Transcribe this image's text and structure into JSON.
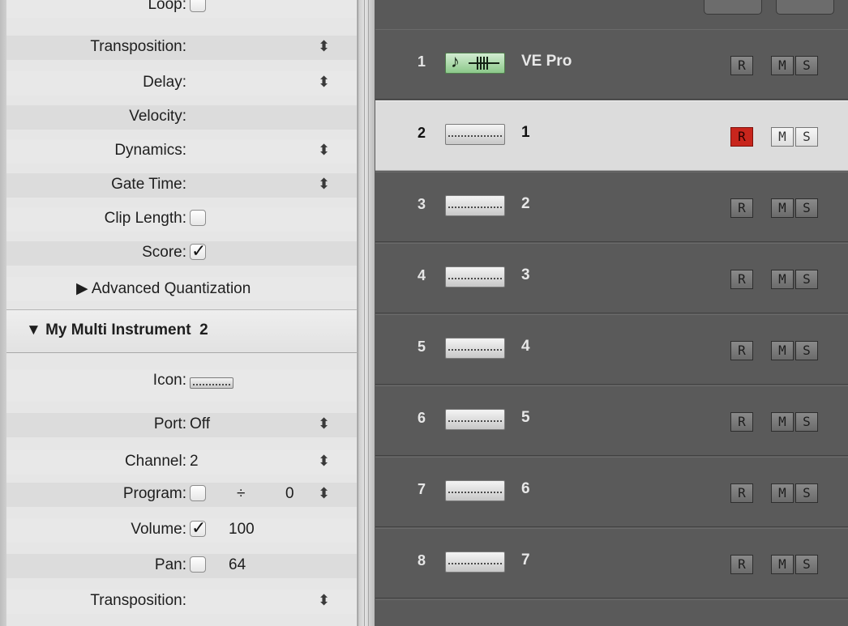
{
  "inspector": {
    "rows_top": [
      {
        "label": "Loop:",
        "type": "checkbox",
        "checked": false
      },
      {
        "label": "Transposition:",
        "type": "stepper",
        "value": ""
      },
      {
        "label": "Delay:",
        "type": "stepper",
        "value": ""
      },
      {
        "label": "Velocity:",
        "type": "none",
        "value": ""
      },
      {
        "label": "Dynamics:",
        "type": "stepper",
        "value": ""
      },
      {
        "label": "Gate Time:",
        "type": "stepper",
        "value": ""
      },
      {
        "label": "Clip Length:",
        "type": "checkbox",
        "checked": false
      },
      {
        "label": "Score:",
        "type": "checkbox",
        "checked": true
      }
    ],
    "advanced_quantization": "▶ Advanced Quantization",
    "section_title": "▼ My Multi Instrument  2",
    "icon_label": "Icon:",
    "port_label": "Port:",
    "port_value": "Off",
    "channel_label": "Channel:",
    "channel_value": "2",
    "program_label": "Program:",
    "program_divider": "÷",
    "program_value": "0",
    "volume_label": "Volume:",
    "volume_value": "100",
    "pan_label": "Pan:",
    "pan_value": "64",
    "transposition2_label": "Transposition:",
    "stepper_glyph": "⬍",
    "checkmark": "✓"
  },
  "tracks": {
    "items": [
      {
        "number": "1",
        "name": "VE Pro",
        "icon": "green-instrument-icon",
        "selected": false,
        "record": false
      },
      {
        "number": "2",
        "name": "1",
        "icon": "keyboard-icon",
        "selected": true,
        "record": true
      },
      {
        "number": "3",
        "name": "2",
        "icon": "keyboard-icon",
        "selected": false,
        "record": false
      },
      {
        "number": "4",
        "name": "3",
        "icon": "keyboard-icon",
        "selected": false,
        "record": false
      },
      {
        "number": "5",
        "name": "4",
        "icon": "keyboard-icon",
        "selected": false,
        "record": false
      },
      {
        "number": "6",
        "name": "5",
        "icon": "keyboard-icon",
        "selected": false,
        "record": false
      },
      {
        "number": "7",
        "name": "6",
        "icon": "keyboard-icon",
        "selected": false,
        "record": false
      },
      {
        "number": "8",
        "name": "7",
        "icon": "keyboard-icon",
        "selected": false,
        "record": false
      }
    ],
    "btn_r": "R",
    "btn_m": "M",
    "btn_s": "S",
    "record_color": "#c8251c"
  }
}
